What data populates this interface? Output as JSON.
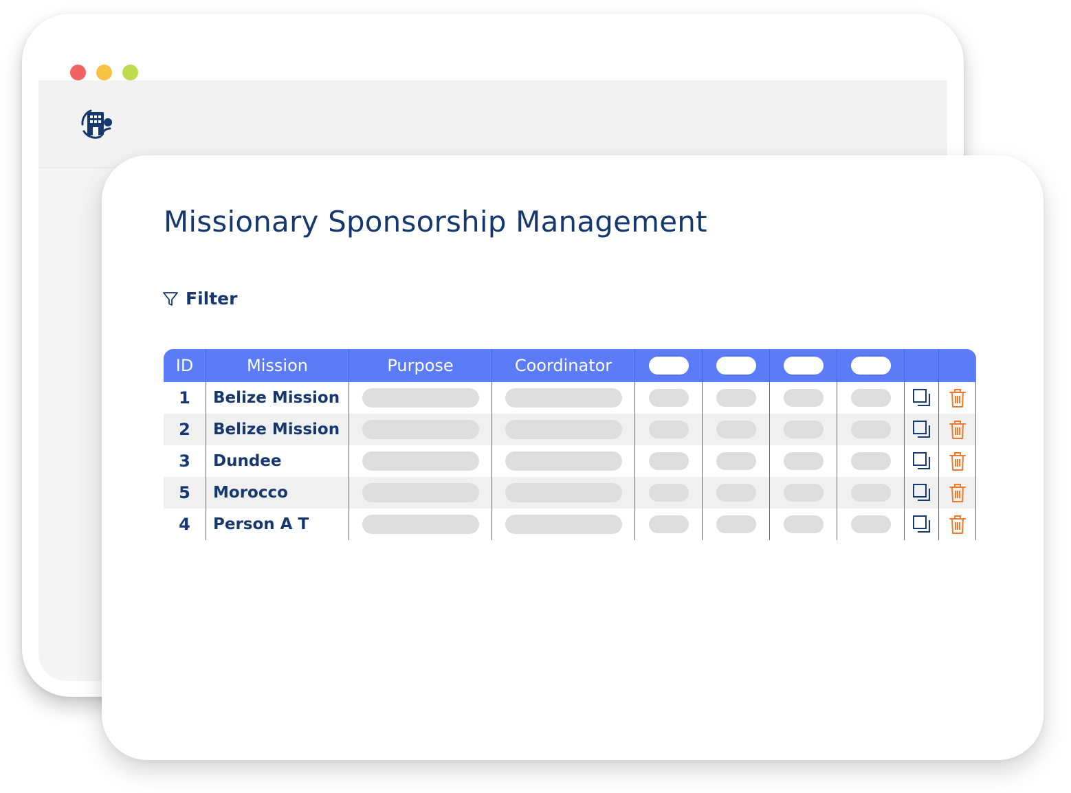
{
  "colors": {
    "brand_navy": "#17376f",
    "table_header": "#5b7cf6",
    "delete_orange": "#f07a2a",
    "traffic_red": "#f06464",
    "traffic_yellow": "#f6c244",
    "traffic_green": "#bedb4d"
  },
  "app": {
    "logo_icon": "building-logo-icon"
  },
  "page": {
    "title": "Missionary Sponsorship Management",
    "filter_label": "Filter",
    "filter_icon": "funnel-icon"
  },
  "table": {
    "headers": [
      "ID",
      "Mission",
      "Purpose",
      "Coordinator"
    ],
    "rows": [
      {
        "id": "1",
        "mission": "Belize Mission"
      },
      {
        "id": "2",
        "mission": "Belize Mission"
      },
      {
        "id": "3",
        "mission": "Dundee"
      },
      {
        "id": "5",
        "mission": "Morocco"
      },
      {
        "id": "4",
        "mission": "Person A T"
      }
    ],
    "row_actions": [
      "copy-icon",
      "trash-icon"
    ]
  }
}
